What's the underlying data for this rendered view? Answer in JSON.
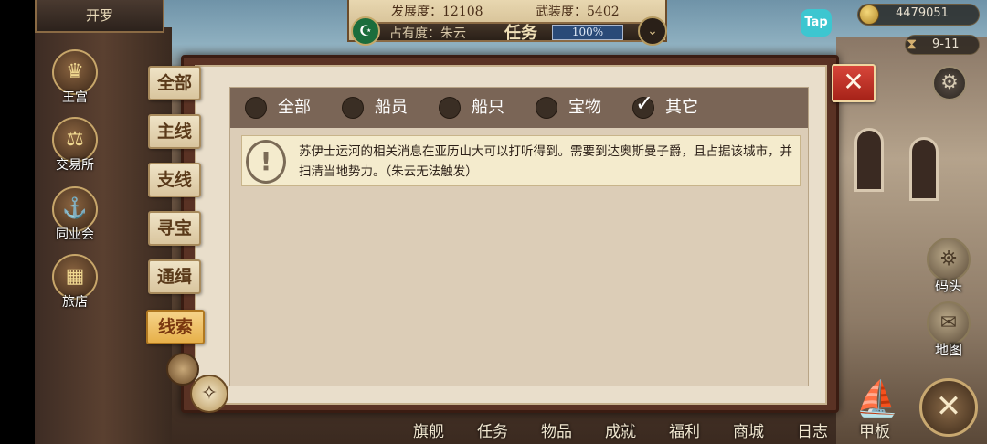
{
  "top": {
    "city": "开罗",
    "development_label": "发展度：12108",
    "armament_label": "武装度：5402",
    "occupancy_label": "占有度：朱云",
    "title": "任务",
    "progress": "100%",
    "gold": "4479051",
    "date": "9-11",
    "tap_label": "Tap"
  },
  "left_nav": [
    {
      "label": "王宫",
      "icon": "crown-icon"
    },
    {
      "label": "交易所",
      "icon": "scales-icon"
    },
    {
      "label": "同业会",
      "icon": "guild-anchor-icon"
    },
    {
      "label": "旅店",
      "icon": "inn-chest-icon"
    }
  ],
  "right_nav": [
    {
      "label": "码头",
      "icon": "dock-icon"
    },
    {
      "label": "地图",
      "icon": "map-scroll-icon"
    }
  ],
  "side_tabs": [
    {
      "label": "全部",
      "active": false
    },
    {
      "label": "主线",
      "active": false
    },
    {
      "label": "支线",
      "active": false
    },
    {
      "label": "寻宝",
      "active": false
    },
    {
      "label": "通缉",
      "active": false
    },
    {
      "label": "线索",
      "active": true
    }
  ],
  "filters": [
    {
      "label": "全部",
      "checked": false
    },
    {
      "label": "船员",
      "checked": false
    },
    {
      "label": "船只",
      "checked": false
    },
    {
      "label": "宝物",
      "checked": false
    },
    {
      "label": "其它",
      "checked": true
    }
  ],
  "quests": [
    {
      "text": "苏伊士运河的相关消息在亚历山大可以打听得到。需要到达奥斯曼子爵，且占据该城市，并扫清当地势力。（朱云无法触发）",
      "icon": "exclamation-icon"
    }
  ],
  "bottom_bar": [
    "旗舰",
    "任务",
    "物品",
    "成就",
    "福利",
    "商城",
    "日志",
    "甲板"
  ],
  "colors": {
    "accent_tab": "#e7b04a",
    "close_red": "#c0392b",
    "dialog_border": "#5a3224",
    "filter_bar": "#7a6556"
  }
}
